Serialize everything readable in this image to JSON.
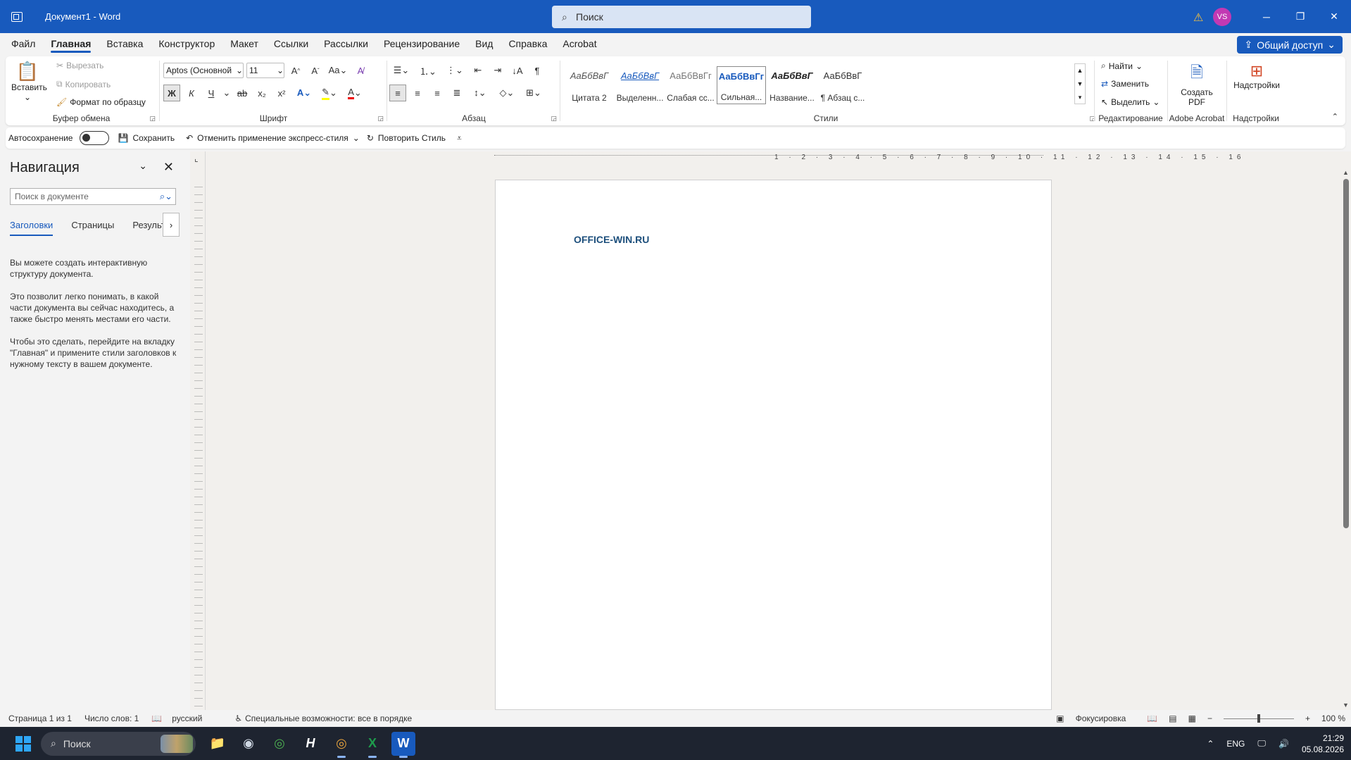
{
  "titlebar": {
    "title": "Документ1 - Word",
    "search_placeholder": "Поиск",
    "avatar_initials": "VS"
  },
  "menu": {
    "tabs": [
      "Файл",
      "Главная",
      "Вставка",
      "Конструктор",
      "Макет",
      "Ссылки",
      "Рассылки",
      "Рецензирование",
      "Вид",
      "Справка",
      "Acrobat"
    ],
    "share": "Общий доступ"
  },
  "ribbon": {
    "clipboard": {
      "paste": "Вставить",
      "cut": "Вырезать",
      "copy": "Копировать",
      "format_painter": "Формат по образцу",
      "label": "Буфер обмена"
    },
    "font": {
      "family": "Aptos (Основной",
      "size": "11",
      "label": "Шрифт",
      "bold": "Ж",
      "italic": "К",
      "underline": "Ч"
    },
    "paragraph": {
      "label": "Абзац"
    },
    "styles": {
      "label": "Стили",
      "items": [
        {
          "sample": "АаБбВвГ",
          "name": "Цитата 2"
        },
        {
          "sample": "АаБбВвГ",
          "name": "Выделенн..."
        },
        {
          "sample": "АаБбВвГг",
          "name": "Слабая сс..."
        },
        {
          "sample": "АаБбВвГг",
          "name": "Сильная..."
        },
        {
          "sample": "АаБбВвГ",
          "name": "Название..."
        },
        {
          "sample": "АаБбВвГ",
          "name": "¶ Абзац с..."
        }
      ]
    },
    "editing": {
      "find": "Найти",
      "replace": "Заменить",
      "select": "Выделить",
      "label": "Редактирование"
    },
    "acrobat": {
      "create_pdf": "Создать PDF",
      "label": "Adobe Acrobat"
    },
    "addins": {
      "button": "Надстройки",
      "label": "Надстройки"
    }
  },
  "qat": {
    "autosave": "Автосохранение",
    "save": "Сохранить",
    "undo": "Отменить применение экспресс-стиля",
    "redo": "Повторить Стиль"
  },
  "nav": {
    "title": "Навигация",
    "search_placeholder": "Поиск в документе",
    "tabs": [
      "Заголовки",
      "Страницы",
      "Результа"
    ],
    "paragraphs": [
      "Вы можете создать интерактивную структуру документа.",
      "Это позволит легко понимать, в какой части документа вы сейчас находитесь, а также быстро менять местами его части.",
      "Чтобы это сделать, перейдите на вкладку \"Главная\" и примените стили заголовков к нужному тексту в вашем документе."
    ]
  },
  "document": {
    "text": "OFFICE-WIN.RU",
    "ruler_numbers": "1 · 2 · 3 · 4 · 5 · 6 · 7 · 8 · 9 · 10 · 11 · 12 · 13 · 14 · 15 · 16"
  },
  "status": {
    "page": "Страница 1 из 1",
    "words": "Число слов: 1",
    "language": "русский",
    "accessibility": "Специальные возможности: все в порядке",
    "focus": "Фокусировка",
    "zoom": "100 %"
  },
  "taskbar": {
    "search": "Поиск",
    "lang": "ENG",
    "time": "21:29",
    "date": "05.08.2026"
  },
  "colors": {
    "accent": "#185abd",
    "doc_text": "#1d4f7c",
    "avatar": "#c239b3"
  }
}
